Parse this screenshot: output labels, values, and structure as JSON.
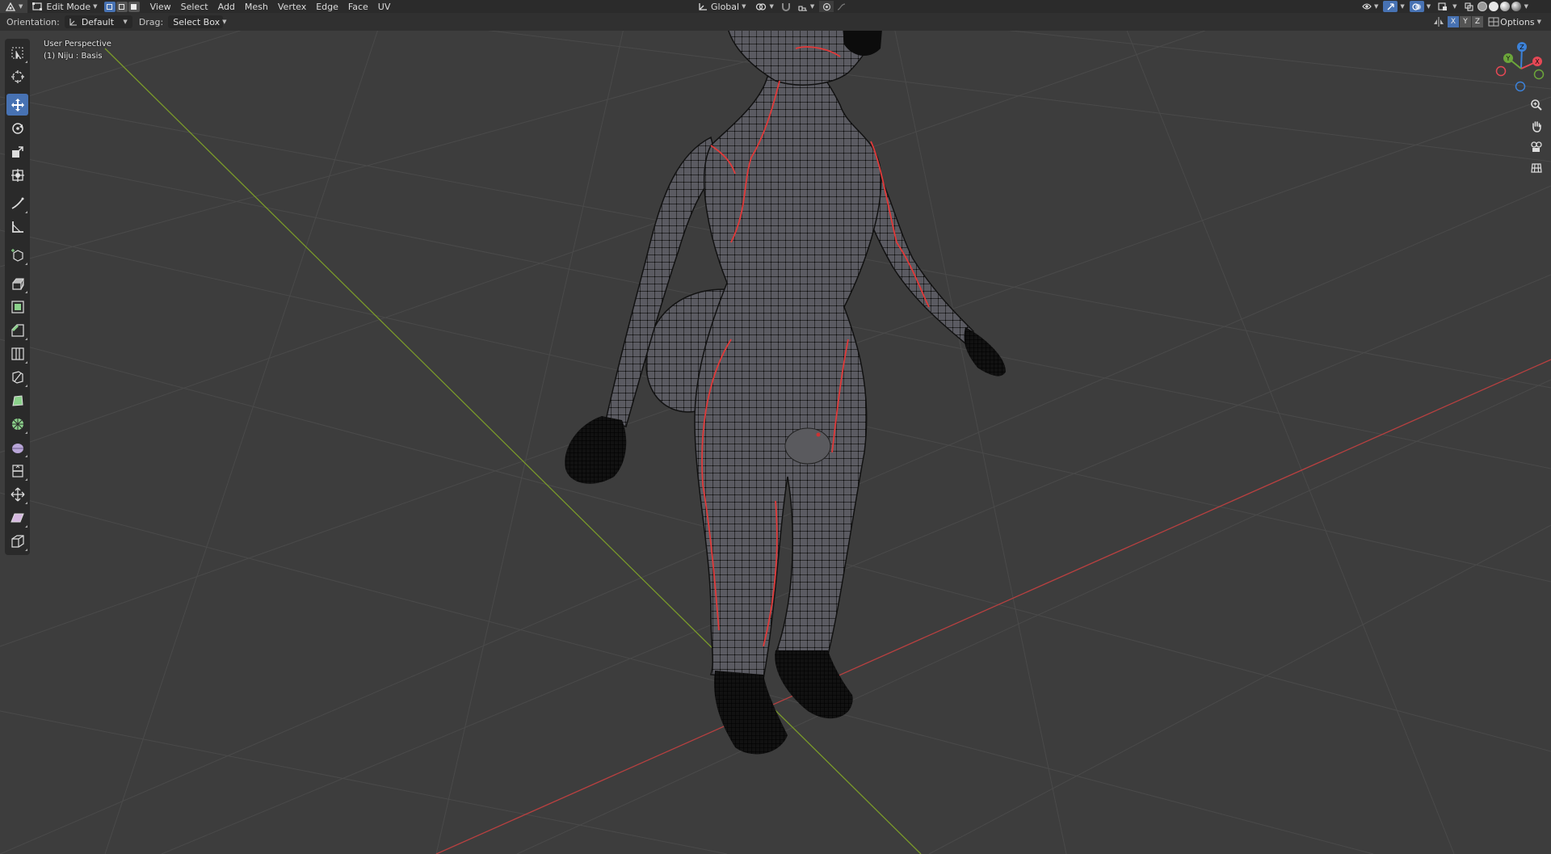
{
  "header": {
    "editor_type_icon": "3d-viewport-icon",
    "mode": "Edit Mode",
    "menus": [
      "View",
      "Select",
      "Add",
      "Mesh",
      "Vertex",
      "Edge",
      "Face",
      "UV"
    ],
    "transform_orientation": "Global",
    "snap_icon": "magnet-icon",
    "proportional_icon": "proportional-edit-icon"
  },
  "tool_settings": {
    "orientation_label": "Orientation:",
    "orientation_value": "Default",
    "drag_label": "Drag:",
    "drag_value": "Select Box",
    "axis_x": "X",
    "axis_y": "Y",
    "axis_z": "Z",
    "options_label": "Options"
  },
  "viewport": {
    "view_name": "User Perspective",
    "object_info": "(1) Niju : Basis"
  },
  "gizmo": {
    "x": "X",
    "y": "Y",
    "z": "Z",
    "colors": {
      "x": "#e64855",
      "y": "#6ca63a",
      "z": "#3c82d9"
    }
  },
  "tools": [
    "select-box-icon",
    "cursor-icon",
    "move-icon",
    "rotate-icon",
    "scale-icon",
    "transform-icon",
    "annotate-icon",
    "measure-icon",
    "add-cube-icon",
    "extrude-icon",
    "inset-icon",
    "bevel-icon",
    "loop-cut-icon",
    "knife-icon",
    "poly-build-icon",
    "spin-icon",
    "smooth-icon",
    "edge-slide-icon",
    "shrink-fatten-icon",
    "shear-icon",
    "rip-icon"
  ],
  "colors": {
    "accent": "#4772b3",
    "x_axis_line": "#b84040",
    "y_axis_line": "#7a9a2a",
    "seam": "#e03a3a"
  }
}
